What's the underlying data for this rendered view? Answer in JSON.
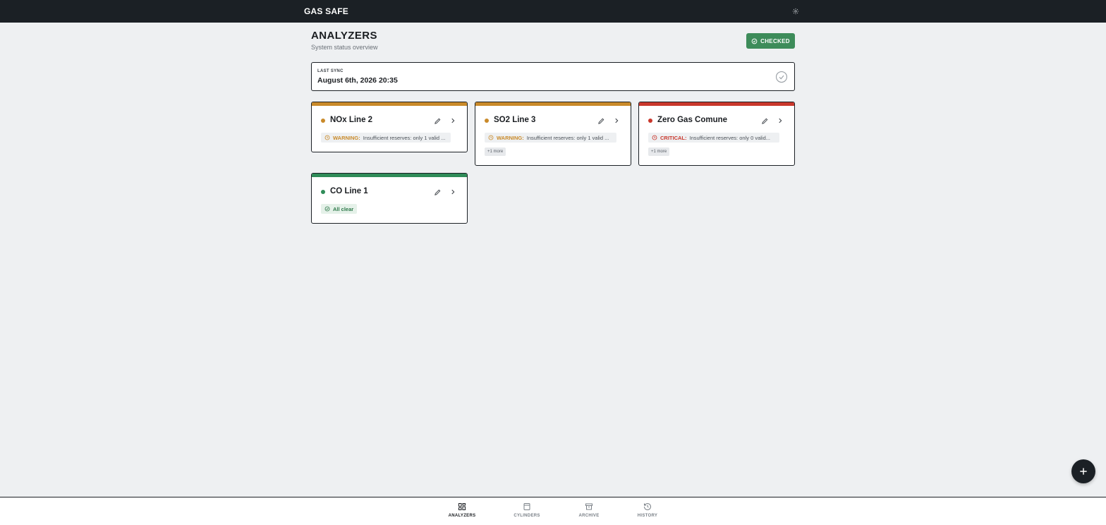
{
  "header": {
    "brand": "GAS SAFE",
    "settings_icon": "gear-icon"
  },
  "page": {
    "title": "ANALYZERS",
    "subtitle": "System status overview",
    "checked_label": "CHECKED"
  },
  "sync": {
    "label": "LAST SYNC",
    "value": "August 6th, 2026 20:35"
  },
  "colors": {
    "warning": "#c98a2a",
    "critical": "#c9372c",
    "ok": "#2f8c58"
  },
  "analyzers": [
    {
      "name": "NOx Line 2",
      "status": "warning",
      "alert_tag": "WARNING:",
      "alert_msg": "Insufficient reserves: only 1 valid ...",
      "more": ""
    },
    {
      "name": "SO2 Line 3",
      "status": "warning",
      "alert_tag": "WARNING:",
      "alert_msg": "Insufficient reserves: only 1 valid ...",
      "more": "+1 more"
    },
    {
      "name": "Zero Gas Comune",
      "status": "critical",
      "alert_tag": "CRITICAL:",
      "alert_msg": "Insufficient reserves: only 0 valid...",
      "more": "+1 more"
    },
    {
      "name": "CO Line 1",
      "status": "ok",
      "ok_label": "All clear"
    }
  ],
  "nav": [
    {
      "label": "ANALYZERS",
      "icon": "dashboard-icon",
      "active": true
    },
    {
      "label": "CYLINDERS",
      "icon": "cylinder-icon",
      "active": false
    },
    {
      "label": "ARCHIVE",
      "icon": "archive-icon",
      "active": false
    },
    {
      "label": "HISTORY",
      "icon": "history-icon",
      "active": false
    }
  ],
  "fab_icon": "plus-icon"
}
